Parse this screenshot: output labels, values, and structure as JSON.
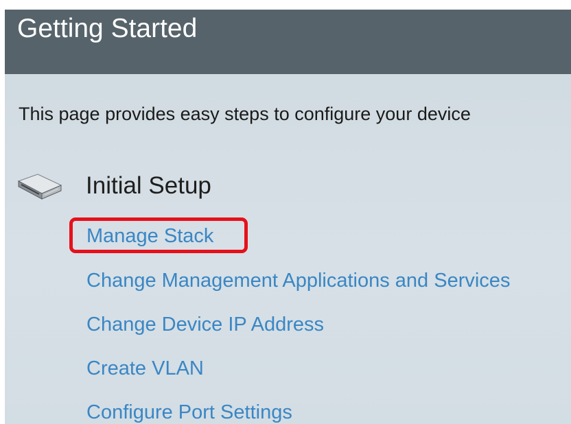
{
  "header": {
    "title": "Getting Started"
  },
  "intro_text": "This page provides easy steps to configure your device",
  "section": {
    "title": "Initial Setup",
    "icon": "network-switch-icon",
    "links": [
      {
        "label": "Manage Stack",
        "highlighted": true
      },
      {
        "label": "Change Management Applications and Services"
      },
      {
        "label": "Change Device IP Address"
      },
      {
        "label": "Create VLAN"
      },
      {
        "label": "Configure Port Settings"
      }
    ]
  },
  "colors": {
    "header_bg": "#56636b",
    "link": "#3a86c4",
    "highlight": "#e6101a"
  }
}
